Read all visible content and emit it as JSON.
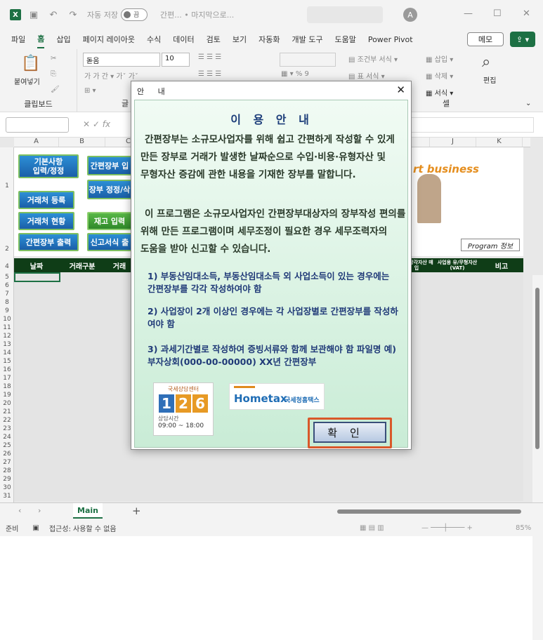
{
  "titlebar": {
    "app_icon": "X",
    "autosave_label": "자동 저장",
    "autosave_state": "끔",
    "doc_title": "간편... • 마지막으로...",
    "avatar": "A"
  },
  "menu": {
    "items": [
      "파일",
      "홈",
      "삽입",
      "페이지 레이아웃",
      "수식",
      "데이터",
      "검토",
      "보기",
      "자동화",
      "개발 도구",
      "도움말",
      "Power Pivot"
    ],
    "active": "홈",
    "memo_label": "메모"
  },
  "ribbon": {
    "paste_label": "붙여넣기",
    "clipboard_group": "클립보드",
    "font_name": "돋움",
    "font_size": "10",
    "font_group": "글",
    "cond_format": "조건부 서식",
    "table_format": "표 서식",
    "insert": "삽입",
    "delete": "삭제",
    "format": "서식",
    "cell_group": "셀",
    "edit_label": "편집"
  },
  "sheet": {
    "columns": [
      "A",
      "B",
      "C",
      "D",
      "E",
      "F",
      "G",
      "H",
      "I",
      "J",
      "K"
    ],
    "rows": [
      "1",
      "2",
      "4",
      "5",
      "6",
      "7",
      "8",
      "9",
      "10",
      "11",
      "12",
      "13",
      "14",
      "15",
      "16",
      "17",
      "18",
      "19",
      "20",
      "21",
      "22",
      "23",
      "24",
      "25",
      "26",
      "27",
      "28",
      "29",
      "30",
      "31"
    ],
    "buttons": {
      "basic_info": "기본사항\n입력/정정",
      "ledger_input": "간편장부 입",
      "ledger_fix": "장부 정정/삭",
      "vendor_reg": "거래처 등록",
      "vendor_status": "거래처 현황",
      "stock": "재고 입력",
      "ledger_print": "간편장부 출력",
      "report_form": "신고서식 출"
    },
    "banner_text": "rt business",
    "program_info": "Program 정보",
    "header_row": [
      "날짜",
      "거래구분",
      "거래",
      "감가상각자산 매입",
      "사업용 유/무형자산(VAT)",
      "비고"
    ],
    "tab_name": "Main"
  },
  "status": {
    "ready": "준비",
    "accessibility": "접근성: 사용할 수 없음",
    "zoom": "85%"
  },
  "dialog": {
    "title": "안 내",
    "heading": "이 용 안 내",
    "para1": "간편장부는 소규모사업자를 위해 쉽고 간편하게 작성할 수 있게 만든 장부로 거래가 발생한 날짜순으로 수입·비용·유형자산 및 무형자산 증감에 관한 내용을 기재한 장부를 말합니다.",
    "para2": "이 프로그램은 소규모사업자인 간편장부대상자의 장부작성 편의를 위해 만든 프로그램이며 세무조정이 필요한 경우 세무조력자의 도움을 받아 신고할 수 있습니다.",
    "note1": "1) 부동산임대소득, 부동산임대소득 외 사업소득이 있는 경우에는 간편장부를 각각 작성하여야 함",
    "note2": "2) 사업장이 2개 이상인 경우에는 각 사업장별로 간편장부를 작성하여야 함",
    "note3": "3) 과세기간별로 작성하여 증빙서류와 함께 보관해야 함 파일명 예) 부자상회(000-00-00000) XX년 간편장부",
    "logo126_top": "국세상담센터",
    "logo126_num": [
      "1",
      "2",
      "6"
    ],
    "logo126_hours_label": "상담시간",
    "logo126_hours": "09:00 ~ 18:00",
    "hometax_name": "Hometax",
    "hometax_kor": "국세청홈택스",
    "ok_label": "확인"
  }
}
